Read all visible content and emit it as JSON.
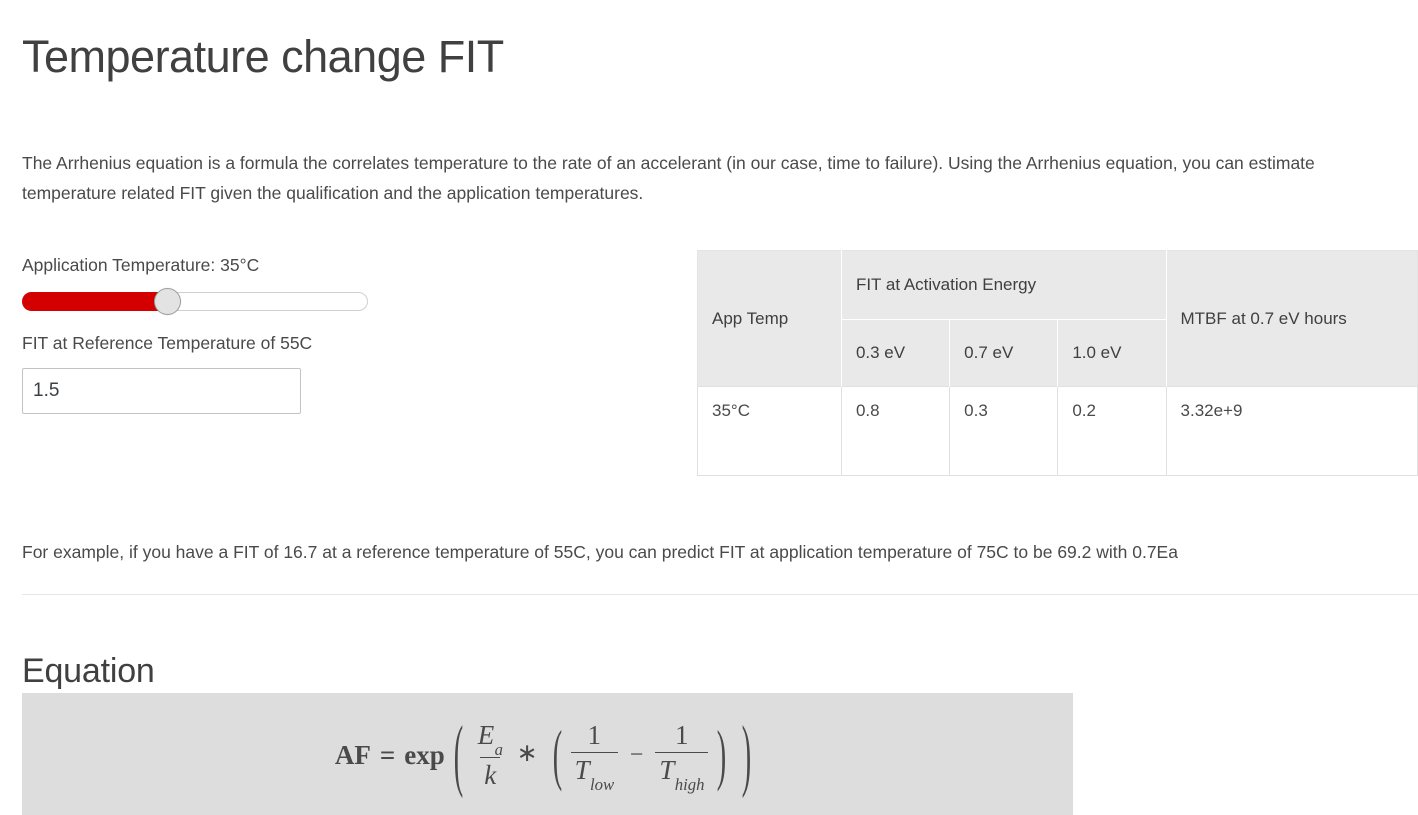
{
  "page": {
    "title": "Temperature change FIT",
    "intro": "The Arrhenius equation is a formula the correlates temperature to the rate of an accelerant (in our case, time to failure). Using the Arrhenius equation, you can estimate temperature related FIT given the qualification and the application temperatures.",
    "example": "For example, if you have a FIT of 16.7 at a reference temperature of 55C, you can predict FIT at application temperature of 75C to be 69.2 with 0.7Ea"
  },
  "controls": {
    "slider": {
      "label": "Application Temperature: 35°C",
      "value": 35,
      "fill_percent": 42,
      "fill_color": "#d40000",
      "thumb_color": "#e3e3e3"
    },
    "fit_input": {
      "label": "FIT at Reference Temperature of 55C",
      "value": "1.5",
      "placeholder": ""
    }
  },
  "table": {
    "header_group": {
      "app_temp": "App Temp",
      "fit_group": "FIT at Activation Energy",
      "mtbf": "MTBF at 0.7 eV hours"
    },
    "subheaders": [
      "0.3 eV",
      "0.7 eV",
      "1.0 eV"
    ],
    "rows": [
      {
        "app_temp": "35°C",
        "fit_03": "0.8",
        "fit_07": "0.3",
        "fit_10": "0.2",
        "mtbf": "3.32e+9"
      }
    ]
  },
  "equation_section": {
    "heading": "Equation",
    "formula_text": "AF = exp( Ea / k * ( 1/T_low - 1/T_high ) )",
    "parts": {
      "af": "AF",
      "equals": "=",
      "exp": "exp",
      "ea": "E",
      "ea_sub": "a",
      "k": "k",
      "star": "∗",
      "one_a": "1",
      "t_low": "T",
      "t_low_sub": "low",
      "minus": "−",
      "one_b": "1",
      "t_high": "T",
      "t_high_sub": "high",
      "lparen": "(",
      "rparen": ")"
    }
  }
}
